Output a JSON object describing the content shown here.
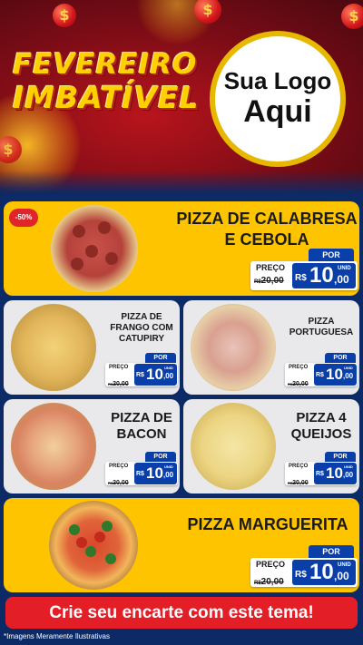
{
  "hero": {
    "title_line1": "FEVEREIRO",
    "title_line2": "IMBATÍVEL",
    "logo_line1": "Sua Logo",
    "logo_line2": "Aqui",
    "coin_symbol": "$"
  },
  "products": [
    {
      "name_line1": "PIZZA DE CALABRESA",
      "name_line2": "E CEBOLA",
      "badge": "-50%",
      "por": "POR",
      "preco": "PREÇO",
      "old_prefix": "R$",
      "old_price": "20,00",
      "currency": "R$",
      "price": "10",
      "cents": ",00",
      "unit": "UNID"
    },
    {
      "name_line1": "PIZZA DE",
      "name_line2": "FRANGO COM",
      "name_line3": "CATUPIRY",
      "por": "POR",
      "preco": "PREÇO",
      "old_prefix": "R$",
      "old_price": "20,00",
      "currency": "R$",
      "price": "10",
      "cents": ",00",
      "unit": "UNID"
    },
    {
      "name_line1": "PIZZA",
      "name_line2": "PORTUGUESA",
      "por": "POR",
      "preco": "PREÇO",
      "old_prefix": "R$",
      "old_price": "20,00",
      "currency": "R$",
      "price": "10",
      "cents": ",00",
      "unit": "UNID"
    },
    {
      "name_line1": "PIZZA DE",
      "name_line2": "BACON",
      "por": "POR",
      "preco": "PREÇO",
      "old_prefix": "R$",
      "old_price": "20,00",
      "currency": "R$",
      "price": "10",
      "cents": ",00",
      "unit": "UNID"
    },
    {
      "name_line1": "PIZZA 4",
      "name_line2": "QUEIJOS",
      "por": "POR",
      "preco": "PREÇO",
      "old_prefix": "R$",
      "old_price": "20,00",
      "currency": "R$",
      "price": "10",
      "cents": ",00",
      "unit": "UNID"
    },
    {
      "name_line1": "PIZZA MARGUERITA",
      "por": "POR",
      "preco": "PREÇO",
      "old_prefix": "R$",
      "old_price": "20,00",
      "currency": "R$",
      "price": "10",
      "cents": ",00",
      "unit": "UNID"
    }
  ],
  "cta": "Crie seu encarte com este tema!",
  "disclaimer": "*Imagens Meramente Ilustrativas",
  "colors": {
    "background": "#0c2a66",
    "hero_red": "#b8141c",
    "yellow": "#ffc400",
    "title_yellow": "#ffd000",
    "price_blue": "#0a3ea8",
    "cta_red": "#e41e26"
  }
}
